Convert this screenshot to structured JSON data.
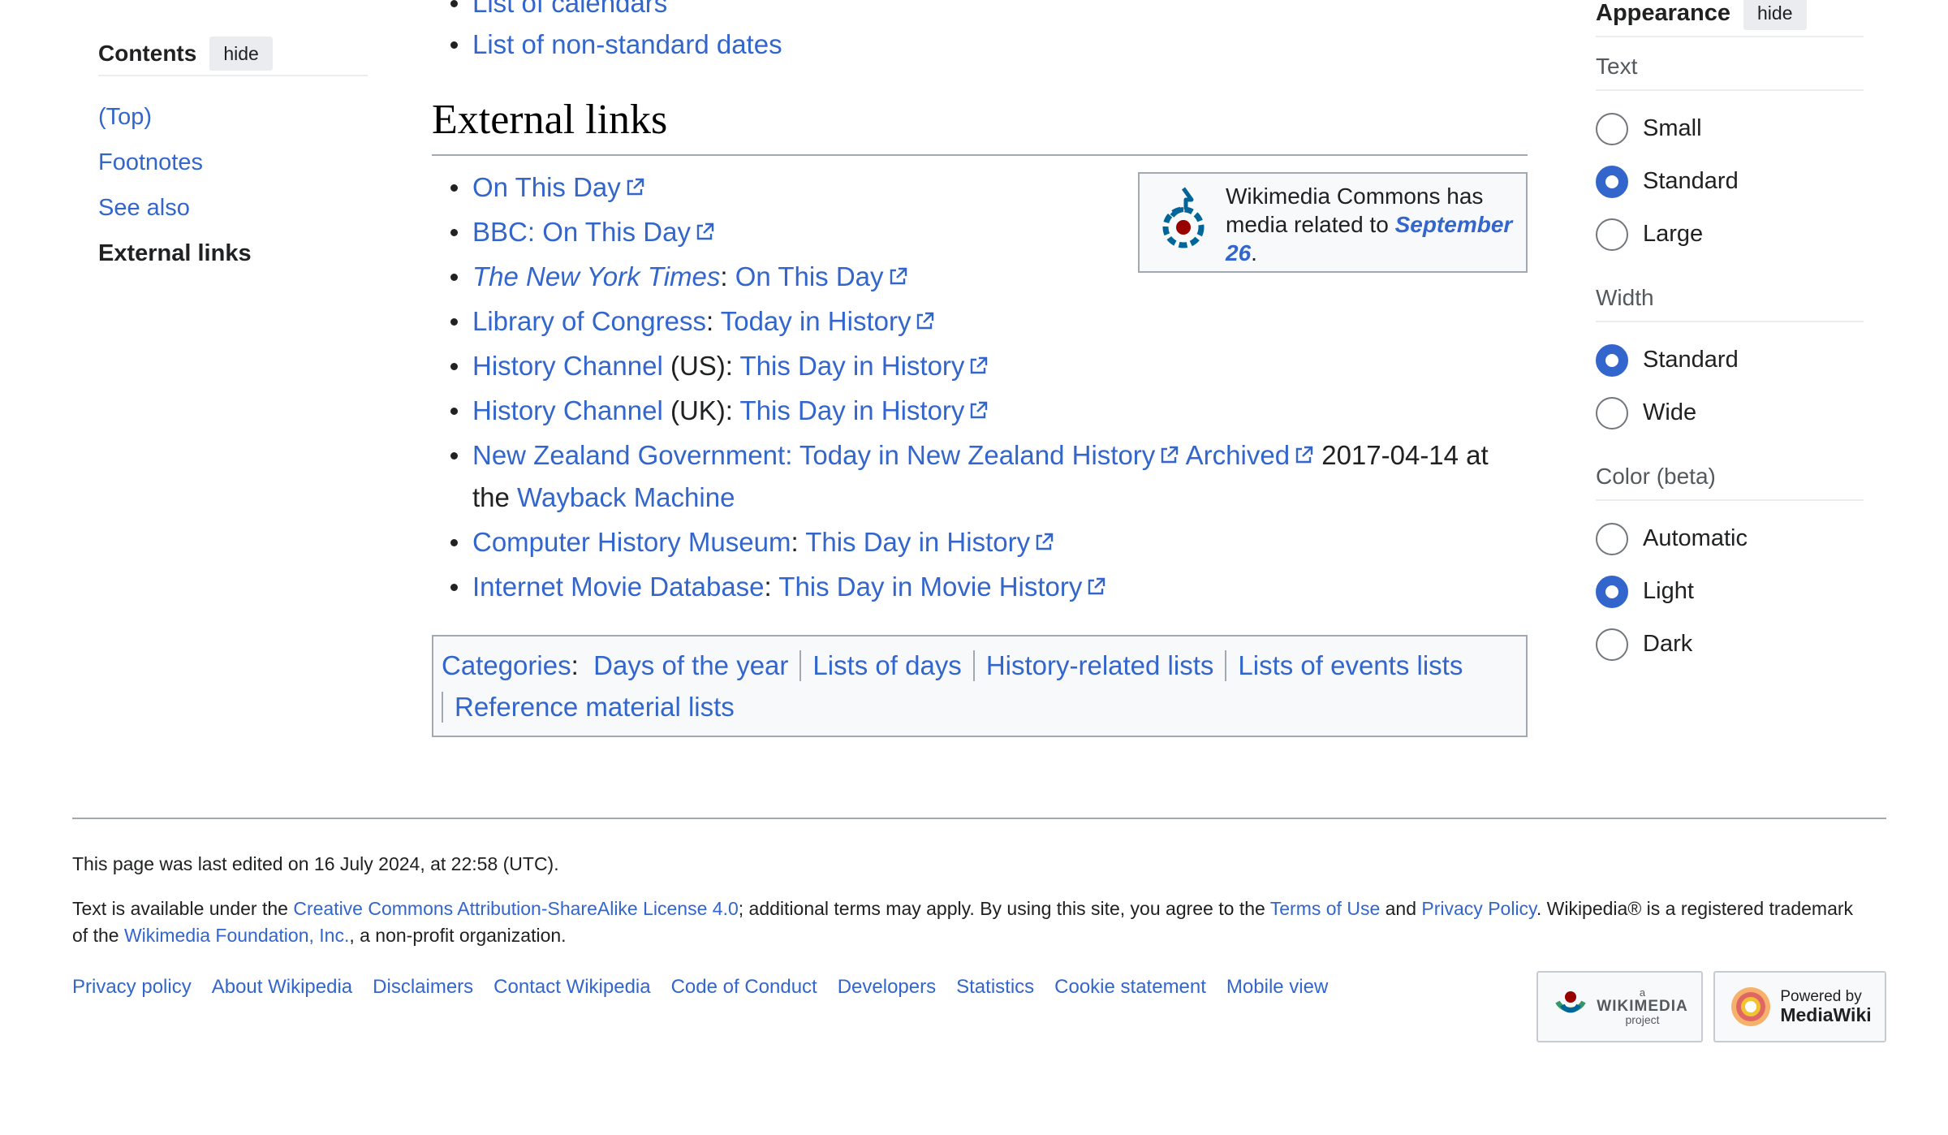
{
  "toc": {
    "title": "Contents",
    "hide_label": "hide",
    "items": [
      {
        "label": "(Top)"
      },
      {
        "label": "Footnotes"
      },
      {
        "label": "See also"
      },
      {
        "label": "External links"
      }
    ]
  },
  "main": {
    "prev_items": [
      "List of calendars",
      "List of non-standard dates"
    ],
    "heading": "External links",
    "links": [
      {
        "a": "On This Day"
      },
      {
        "a": "BBC: On This Day"
      },
      {
        "a_italic": "The New York Times",
        "sep": ": ",
        "b": "On This Day"
      },
      {
        "a": "Library of Congress",
        "sep": ": ",
        "b": "Today in History"
      },
      {
        "a": "History Channel",
        "sep": " (US): ",
        "b": "This Day in History"
      },
      {
        "a": "History Channel",
        "sep": " (UK): ",
        "b": "This Day in History"
      },
      {
        "a": "New Zealand Government: Today in New Zealand History",
        "b": "Archived",
        "tail": " 2017-04-14 at the ",
        "c": "Wayback Machine"
      },
      {
        "a": "Computer History Museum",
        "sep": ": ",
        "b": "This Day in History"
      },
      {
        "a": "Internet Movie Database",
        "sep": ": ",
        "b": "This Day in Movie History"
      }
    ],
    "commons_box": {
      "text_before": "Wikimedia Commons has media related to ",
      "link": "September 26",
      "text_after": "."
    },
    "categories": {
      "label": "Categories",
      "colon": ":",
      "items": [
        "Days of the year",
        "Lists of days",
        "History-related lists",
        "Lists of events lists",
        "Reference material lists"
      ]
    }
  },
  "appearance": {
    "title": "Appearance",
    "hide_label": "hide",
    "sections": [
      {
        "label": "Text",
        "options": [
          {
            "label": "Small",
            "selected": false
          },
          {
            "label": "Standard",
            "selected": true
          },
          {
            "label": "Large",
            "selected": false
          }
        ]
      },
      {
        "label": "Width",
        "options": [
          {
            "label": "Standard",
            "selected": true
          },
          {
            "label": "Wide",
            "selected": false
          }
        ]
      },
      {
        "label": "Color (beta)",
        "options": [
          {
            "label": "Automatic",
            "selected": false
          },
          {
            "label": "Light",
            "selected": true
          },
          {
            "label": "Dark",
            "selected": false
          }
        ]
      }
    ]
  },
  "footer": {
    "last_edited": "This page was last edited on 16 July 2024, at 22:58 (UTC).",
    "license": {
      "t1": "Text is available under the ",
      "l1": "Creative Commons Attribution-ShareAlike License 4.0",
      "t2": "; additional terms may apply. By using this site, you agree to the ",
      "l2": "Terms of Use",
      "t3": " and ",
      "l3": "Privacy Policy",
      "t4": ". Wikipedia® is a registered trademark of the ",
      "l4": "Wikimedia Foundation, Inc.",
      "t5": ", a non-profit organization."
    },
    "links": [
      "Privacy policy",
      "About Wikipedia",
      "Disclaimers",
      "Contact Wikipedia",
      "Code of Conduct",
      "Developers",
      "Statistics",
      "Cookie statement",
      "Mobile view"
    ],
    "badge_wikimedia": {
      "small": "a",
      "big": "WIKIMEDIA",
      "sub": "project"
    },
    "badge_mediawiki": {
      "small": "Powered by",
      "big": "MediaWiki"
    }
  },
  "colors": {
    "link": "#3366cc",
    "text": "#202122",
    "border": "#a2a9b1",
    "radio_on": "#3366cc"
  }
}
